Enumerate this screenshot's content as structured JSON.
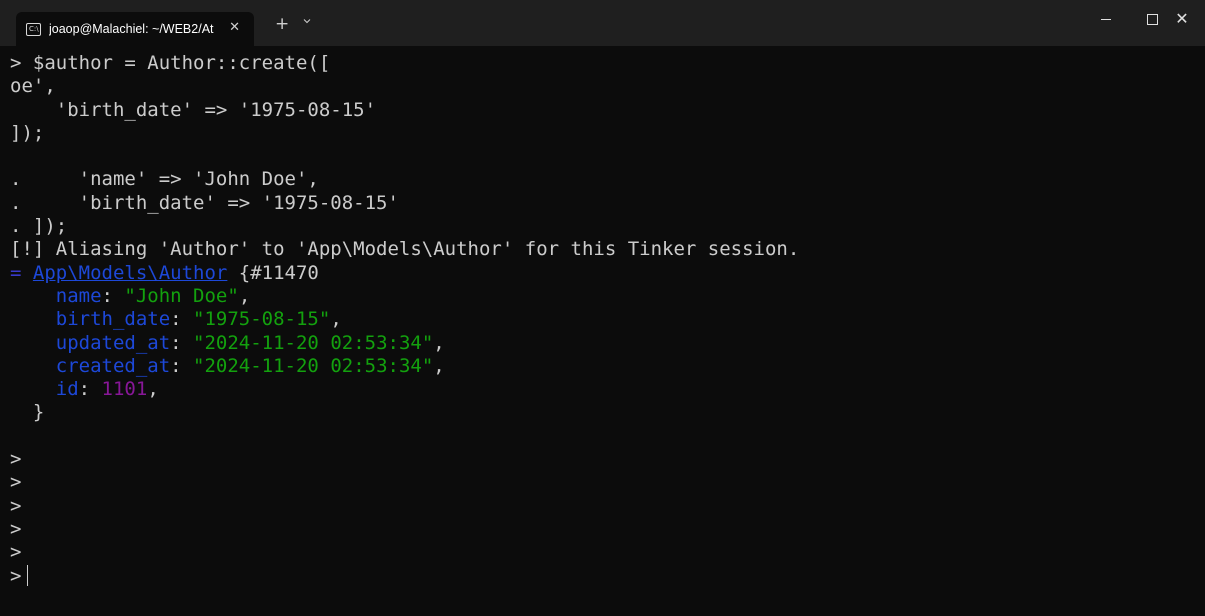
{
  "window": {
    "tab_title": "joaop@Malachiel: ~/WEB2/At",
    "tab_icon_glyph": "C:\\",
    "tab_close_glyph": "✕",
    "new_tab_glyph": "+",
    "close_glyph": "✕",
    "icons": [
      "terminal-icon",
      "close-icon",
      "plus-icon",
      "chevron-down-icon",
      "minimize-icon",
      "maximize-icon",
      "close-icon"
    ]
  },
  "colors": {
    "background": "#0c0c0c",
    "text": "#cccccc",
    "key": "#1d48d8",
    "string": "#13a10e",
    "number": "#881798"
  },
  "terminal": {
    "lines": [
      "> $author = Author::create([",
      "oe',",
      "    'birth_date' => '1975-08-15'",
      "]);",
      "",
      ".     'name' => 'John Doe',",
      ".     'birth_date' => '1975-08-15'",
      ". ]);",
      "[!] Aliasing 'Author' to 'App\\Models\\Author' for this Tinker session."
    ],
    "result": {
      "prefix": "= ",
      "class_link": "App\\Models\\Author",
      "object_id": " {#11470",
      "fields": [
        {
          "key": "name",
          "sep": ": ",
          "value": "\"John Doe\"",
          "type": "string"
        },
        {
          "key": "birth_date",
          "sep": ": ",
          "value": "\"1975-08-15\"",
          "type": "string"
        },
        {
          "key": "updated_at",
          "sep": ": ",
          "value": "\"2024-11-20 02:53:34\"",
          "type": "string"
        },
        {
          "key": "created_at",
          "sep": ": ",
          "value": "\"2024-11-20 02:53:34\"",
          "type": "string"
        },
        {
          "key": "id",
          "sep": ": ",
          "value": "1101",
          "type": "number"
        }
      ],
      "close": "  }"
    },
    "prompts": [
      ">",
      ">",
      ">",
      ">",
      ">",
      ">"
    ]
  }
}
